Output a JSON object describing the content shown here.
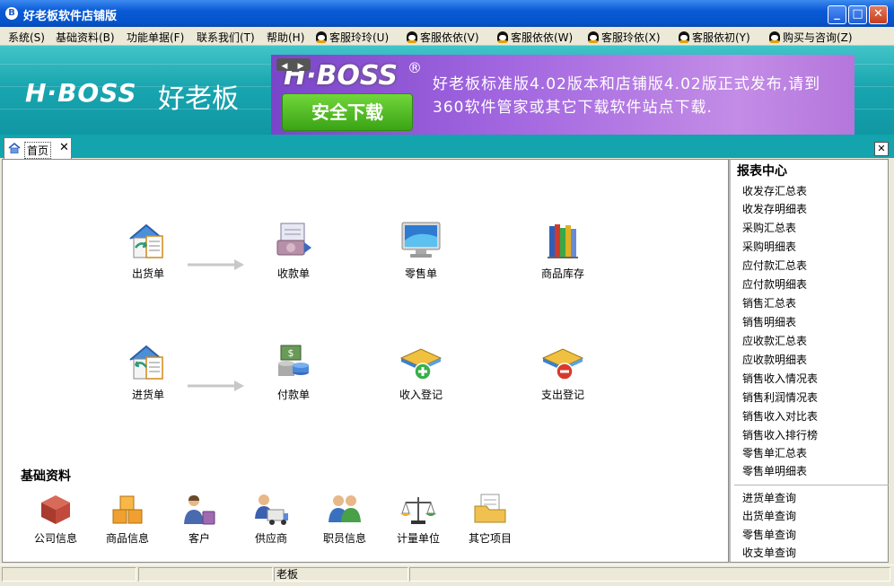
{
  "window": {
    "title": "好老板软件店铺版",
    "icon_letter": "B"
  },
  "menu": [
    {
      "label": "系统(S)",
      "qq": false
    },
    {
      "label": "基础资料(B)",
      "qq": false
    },
    {
      "label": "功能单据(F)",
      "qq": false
    },
    {
      "label": "联系我们(T)",
      "qq": false
    },
    {
      "label": "帮助(H)",
      "qq": false
    },
    {
      "label": "客服玲玲(U)",
      "qq": true
    },
    {
      "label": "客服依依(V)",
      "qq": true
    },
    {
      "label": "客服依依(W)",
      "qq": true
    },
    {
      "label": "客服玲依(X)",
      "qq": true
    },
    {
      "label": "客服依初(Y)",
      "qq": true
    },
    {
      "label": "购买与咨询(Z)",
      "qq": true
    }
  ],
  "banner": {
    "logo_en": "H·BOSS",
    "logo_cn": "好老板",
    "ad_brand": "H·BOSS",
    "ad_reg": "®",
    "ad_button": "安全下载",
    "ad_text": "好老板标准版4.02版本和店铺版4.02版正式发布,请到360软件管家或其它下载软件站点下载.",
    "ad_prev": "◀",
    "ad_next": "▶"
  },
  "tab": {
    "label": "首页",
    "close": "✕"
  },
  "tabstrip_close": "✕",
  "flow": {
    "row1": [
      "出货单",
      "收款单",
      "零售单",
      "商品库存"
    ],
    "row2": [
      "进货单",
      "付款单",
      "收入登记",
      "支出登记"
    ]
  },
  "basics": {
    "title": "基础资料",
    "items": [
      "公司信息",
      "商品信息",
      "客户",
      "供应商",
      "职员信息",
      "计量单位",
      "其它项目"
    ]
  },
  "reports": {
    "title": "报表中心",
    "items": [
      "收发存汇总表",
      "收发存明细表",
      "采购汇总表",
      "采购明细表",
      "应付款汇总表",
      "应付款明细表",
      "销售汇总表",
      "销售明细表",
      "应收款汇总表",
      "应收款明细表",
      "销售收入情况表",
      "销售利润情况表",
      "销售收入对比表",
      "销售收入排行榜",
      "零售单汇总表",
      "零售单明细表"
    ],
    "queries": [
      "进货单查询",
      "出货单查询",
      "零售单查询",
      "收支单查询"
    ]
  },
  "status": [
    "",
    "",
    "老板",
    ""
  ],
  "colors": {
    "titlebar": "#0a5ad6",
    "banner": "#19a6b0",
    "ad": "#a266e0",
    "download": "#3aa415"
  }
}
